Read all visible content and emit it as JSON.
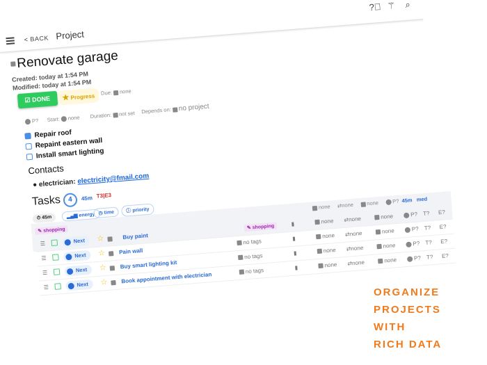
{
  "header": {
    "back": "< BACK",
    "title": "Project",
    "icons": [
      "help-icon",
      "magic-wand-icon",
      "search-icon"
    ]
  },
  "project": {
    "title": "Renovate garage",
    "created": "Created: today at 1:54 PM",
    "modified": "Modified: today at 1:54 PM",
    "status": "DONE",
    "progress": "Progress",
    "due_label": "Due:",
    "due": "none",
    "priority": "P?",
    "start_label": "Start:",
    "start": "none",
    "duration_label": "Duration:",
    "duration": "not set",
    "depends_label": "Depends on:",
    "depends": "no project"
  },
  "checklist": [
    {
      "label": "Repair roof",
      "checked": true
    },
    {
      "label": "Repaint eastern wall",
      "checked": false
    },
    {
      "label": "Install smart lighting",
      "checked": false
    }
  ],
  "contacts": {
    "heading": "Contacts",
    "items": [
      {
        "label": "electrician:",
        "email": "electricity@fmail.com"
      }
    ]
  },
  "tasks": {
    "heading": "Tasks",
    "count": "4",
    "time": "45m",
    "te": "T3",
    "e": "E3",
    "filters": [
      "45m",
      "energy",
      "time",
      "priority"
    ],
    "group": {
      "tag": "shopping",
      "cal": "none",
      "repeat": "none",
      "alarm": "none",
      "priority": "P?",
      "time": "45m",
      "energy": "med"
    },
    "rows": [
      {
        "status": "Next",
        "name": "Buy paint",
        "tag": "shopping",
        "cal": "none",
        "repeat": "none",
        "alarm": "none",
        "p": "P?",
        "t": "T?",
        "e": "E?"
      },
      {
        "status": "Next",
        "name": "Pain wall",
        "tag": "no tags",
        "cal": "none",
        "repeat": "none",
        "alarm": "none",
        "p": "P?",
        "t": "T?",
        "e": "E?"
      },
      {
        "status": "Next",
        "name": "Buy smart lighting kit",
        "tag": "no tags",
        "cal": "none",
        "repeat": "none",
        "alarm": "none",
        "p": "P?",
        "t": "T?",
        "e": "E?"
      },
      {
        "status": "Next",
        "name": "Book appointment with electrician",
        "tag": "no tags",
        "cal": "none",
        "repeat": "none",
        "alarm": "none",
        "p": "P?",
        "t": "T?",
        "e": "E?"
      }
    ]
  },
  "marketing": [
    "ORGANIZE",
    "PROJECTS",
    "WITH",
    "RICH DATA"
  ],
  "colors": {
    "accent": "#2a6bd6",
    "done": "#2ecc5f",
    "marketing": "#f07b1c",
    "tag": "#9c27b0"
  }
}
